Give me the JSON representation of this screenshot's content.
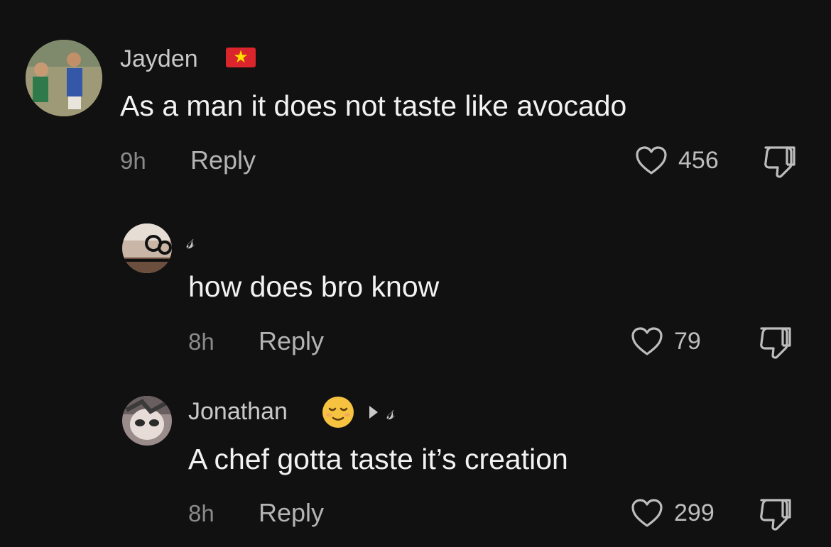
{
  "comments": [
    {
      "username": "Jayden",
      "text": "As a man it does not taste like avocado",
      "time": "9h",
      "reply_label": "Reply",
      "likes": "456",
      "flag_icon": "vietnam-flag-icon"
    },
    {
      "username": "𝓈",
      "text": "how does bro know",
      "time": "8h",
      "reply_label": "Reply",
      "likes": "79"
    },
    {
      "username": "Jonathan",
      "reply_to": "𝓈",
      "text": "A chef gotta taste it’s creation",
      "time": "8h",
      "reply_label": "Reply",
      "likes": "299",
      "emoji_icon": "relieved-face-emoji"
    }
  ],
  "colors": {
    "background": "#111111",
    "username": "#c9c9c9",
    "text": "#f2f2f2",
    "meta": "#8a8a8a",
    "reply": "#b4b4b4"
  }
}
